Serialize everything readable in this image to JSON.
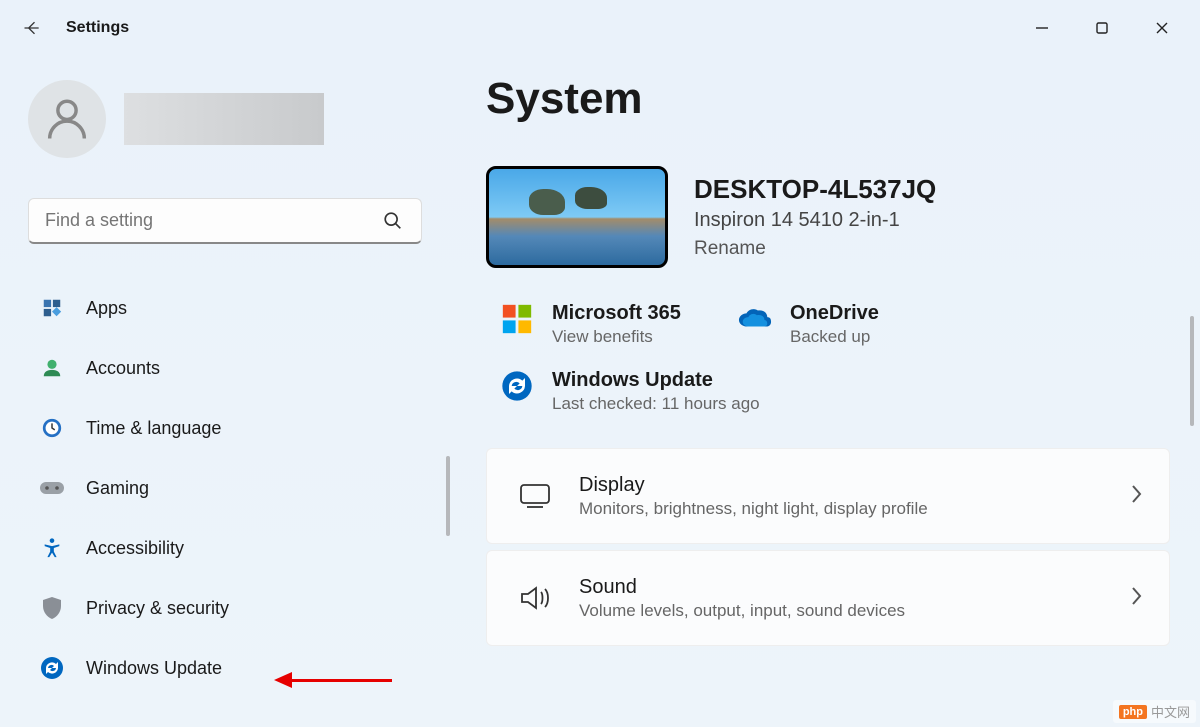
{
  "app": {
    "title": "Settings"
  },
  "search": {
    "placeholder": "Find a setting"
  },
  "sidebar": {
    "items": [
      {
        "label": "Apps"
      },
      {
        "label": "Accounts"
      },
      {
        "label": "Time & language"
      },
      {
        "label": "Gaming"
      },
      {
        "label": "Accessibility"
      },
      {
        "label": "Privacy & security"
      },
      {
        "label": "Windows Update"
      }
    ]
  },
  "page": {
    "title": "System",
    "device": {
      "name": "DESKTOP-4L537JQ",
      "model": "Inspiron 14 5410 2-in-1",
      "rename": "Rename"
    },
    "status": {
      "ms365": {
        "title": "Microsoft 365",
        "sub": "View benefits"
      },
      "onedrive": {
        "title": "OneDrive",
        "sub": "Backed up"
      },
      "winupdate": {
        "title": "Windows Update",
        "sub": "Last checked: 11 hours ago"
      }
    },
    "settings": [
      {
        "title": "Display",
        "sub": "Monitors, brightness, night light, display profile"
      },
      {
        "title": "Sound",
        "sub": "Volume levels, output, input, sound devices"
      }
    ]
  },
  "watermark": "中文网"
}
